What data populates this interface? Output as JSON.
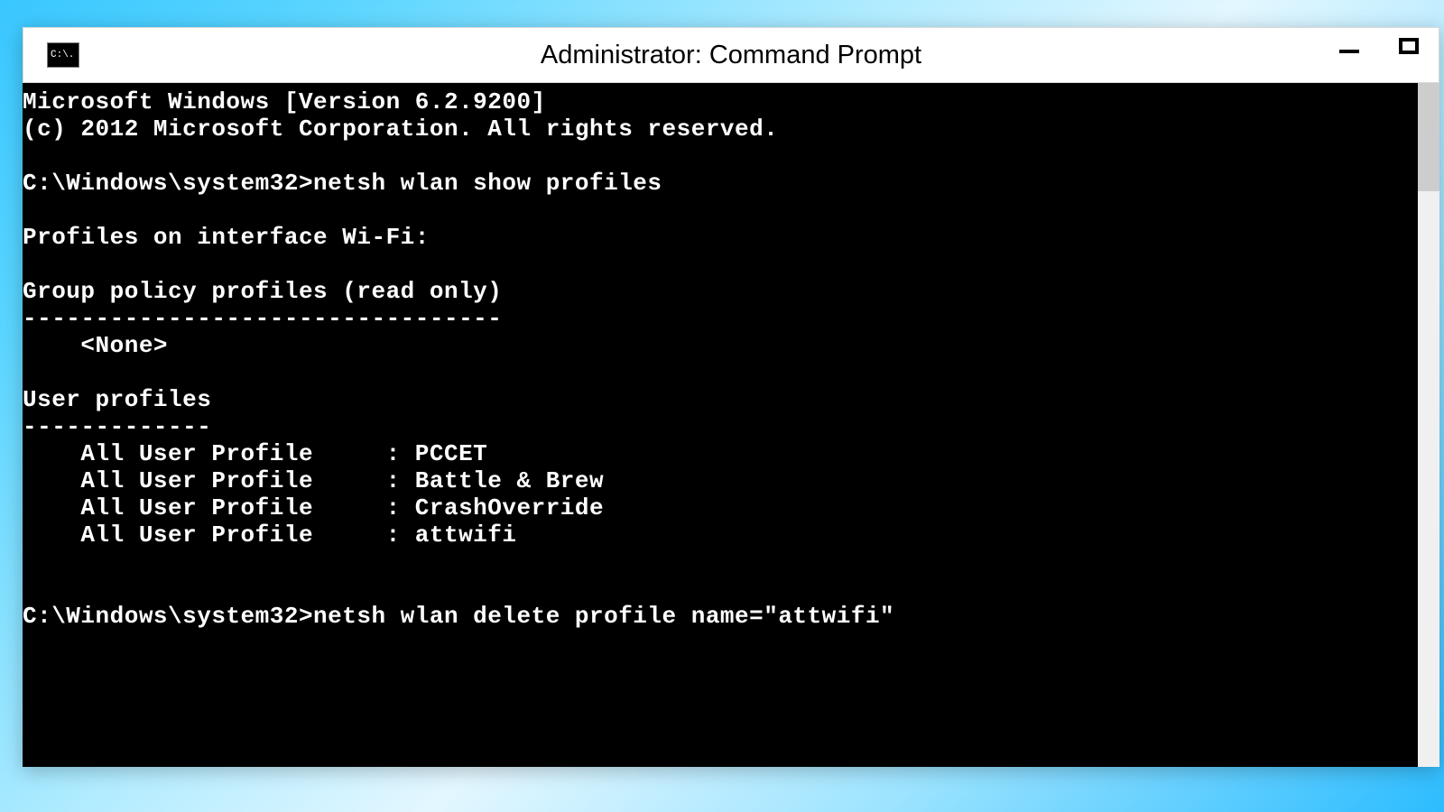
{
  "window": {
    "title": "Administrator: Command Prompt",
    "icon_label": "C:\\."
  },
  "terminal": {
    "lines": [
      "Microsoft Windows [Version 6.2.9200]",
      "(c) 2012 Microsoft Corporation. All rights reserved.",
      "",
      "C:\\Windows\\system32>netsh wlan show profiles",
      "",
      "Profiles on interface Wi-Fi:",
      "",
      "Group policy profiles (read only)",
      "---------------------------------",
      "    <None>",
      "",
      "User profiles",
      "-------------",
      "    All User Profile     : PCCET",
      "    All User Profile     : Battle & Brew",
      "    All User Profile     : CrashOverride",
      "    All User Profile     : attwifi",
      "",
      "",
      "C:\\Windows\\system32>netsh wlan delete profile name=\"attwifi\"",
      ""
    ]
  }
}
